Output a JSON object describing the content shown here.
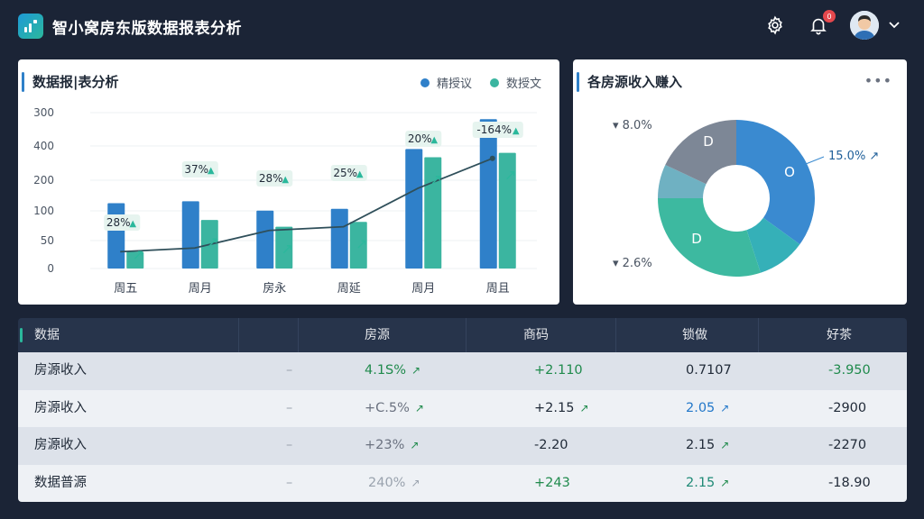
{
  "header": {
    "title": "智小窝房东版数据报表分析",
    "notification_count": "0"
  },
  "bar_card": {
    "title": "数据报|表分析",
    "legend": [
      "精授议",
      "数授文"
    ],
    "colors": [
      "#2f80c9",
      "#3bb5a0"
    ]
  },
  "chart_data": [
    {
      "type": "bar",
      "title": "数据报|表分析",
      "categories": [
        "周五",
        "周月",
        "房永",
        "周延",
        "周月",
        "周且"
      ],
      "y_tick_labels": [
        "300",
        "400",
        "200",
        "100",
        "50",
        "0"
      ],
      "series": [
        {
          "name": "精授议",
          "values": [
            175,
            180,
            155,
            160,
            320,
            400
          ]
        },
        {
          "name": "数授文",
          "values": [
            45,
            130,
            112,
            125,
            298,
            310
          ]
        }
      ],
      "line": [
        45,
        55,
        102,
        112,
        215,
        295
      ],
      "annotations": [
        "28%",
        "37%",
        "28%",
        "25%",
        "20%",
        "-164%"
      ]
    },
    {
      "type": "pie",
      "title": "各房源收入赚入",
      "slices": [
        {
          "label": "15.0%",
          "value": 35,
          "color": "#3a8ad0"
        },
        {
          "label": "",
          "value": 10,
          "color": "#35b0b8"
        },
        {
          "label": "2.6%",
          "value": 30,
          "color": "#3db9a0"
        },
        {
          "label": "",
          "value": 7,
          "color": "#6fb1c2"
        },
        {
          "label": "8.0%",
          "value": 18,
          "color": "#7d8796"
        }
      ],
      "segment_text": [
        "O",
        "D",
        "D"
      ]
    }
  ],
  "pie_card": {
    "title": "各房源收入赚入",
    "labels": {
      "top_left": "▾ 8.0%",
      "right": "15.0%",
      "bottom_left": "▾ 2.6%"
    }
  },
  "table": {
    "headers": [
      "数据",
      "房源",
      "商码",
      "锁做",
      "好茶"
    ],
    "rows": [
      {
        "name": "房源收入",
        "dash": "–",
        "c1": "4.1S%",
        "c2": "+2.110",
        "c3": "0.7107",
        "c4": "-3.950"
      },
      {
        "name": "房源收入",
        "dash": "–",
        "c1": "+C.5%",
        "c2": "+2.15",
        "c3": "2.05",
        "c4": "-2900"
      },
      {
        "name": "房源收入",
        "dash": "–",
        "c1": "+23%",
        "c2": "-2.20",
        "c3": "2.15",
        "c4": "-2270"
      },
      {
        "name": "数据普源",
        "dash": "–",
        "c1": "240%",
        "c2": "+243",
        "c3": "2.15",
        "c4": "-18.90"
      }
    ]
  }
}
